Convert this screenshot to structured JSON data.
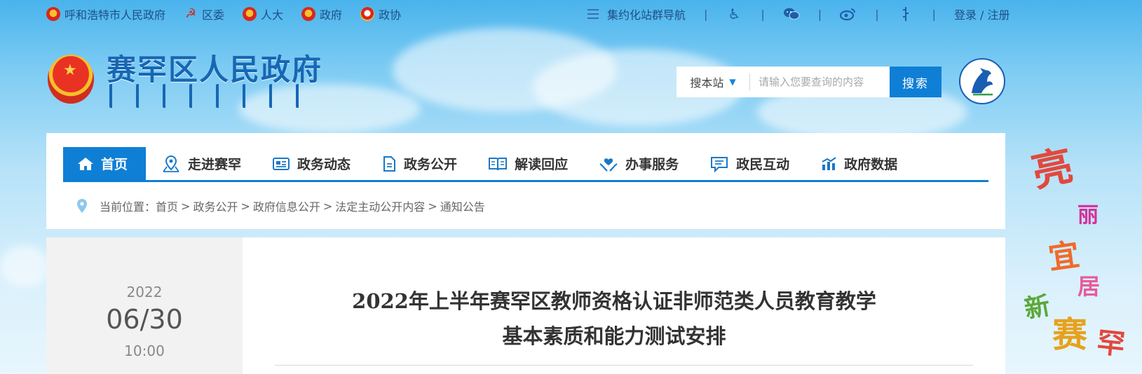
{
  "topbar": {
    "links": [
      {
        "label": "呼和浩特市人民政府",
        "icon": "national-emblem-icon"
      },
      {
        "label": "区委",
        "icon": "party-emblem-icon"
      },
      {
        "label": "人大",
        "icon": "national-emblem-icon"
      },
      {
        "label": "政府",
        "icon": "national-emblem-icon"
      },
      {
        "label": "政协",
        "icon": "cppcc-emblem-icon"
      }
    ],
    "nav_label": "集约化站群导航",
    "login": "登录 / 注册"
  },
  "header": {
    "site_title": "赛罕区人民政府"
  },
  "search": {
    "scope": "搜本站",
    "placeholder": "请输入您要查询的内容",
    "button": "搜索"
  },
  "nav": {
    "items": [
      {
        "label": "首页",
        "icon": "home-icon"
      },
      {
        "label": "走进赛罕",
        "icon": "map-pin-icon"
      },
      {
        "label": "政务动态",
        "icon": "news-icon"
      },
      {
        "label": "政务公开",
        "icon": "document-icon"
      },
      {
        "label": "解读回应",
        "icon": "book-icon"
      },
      {
        "label": "办事服务",
        "icon": "service-hands-icon"
      },
      {
        "label": "政民互动",
        "icon": "chat-icon"
      },
      {
        "label": "政府数据",
        "icon": "chart-icon"
      }
    ]
  },
  "breadcrumb": {
    "prefix": "当前位置：",
    "items": [
      "首页",
      "政务公开",
      "政府信息公开",
      "法定主动公开内容",
      "通知公告"
    ],
    "separator": ">"
  },
  "article": {
    "year": "2022",
    "month_day": "06/30",
    "time": "10:00",
    "title_line1": "2022年上半年赛罕区教师资格认证非师范类人员教育教学",
    "title_line2": "基本素质和能力测试安排"
  },
  "slogan": {
    "c1": "亮",
    "c2": "丽",
    "c3": "宜",
    "c4": "居",
    "c5": "新",
    "c6": "赛",
    "c7": "罕"
  },
  "colors": {
    "accent": "#0f7fd6",
    "title_blue": "#1667b4"
  }
}
